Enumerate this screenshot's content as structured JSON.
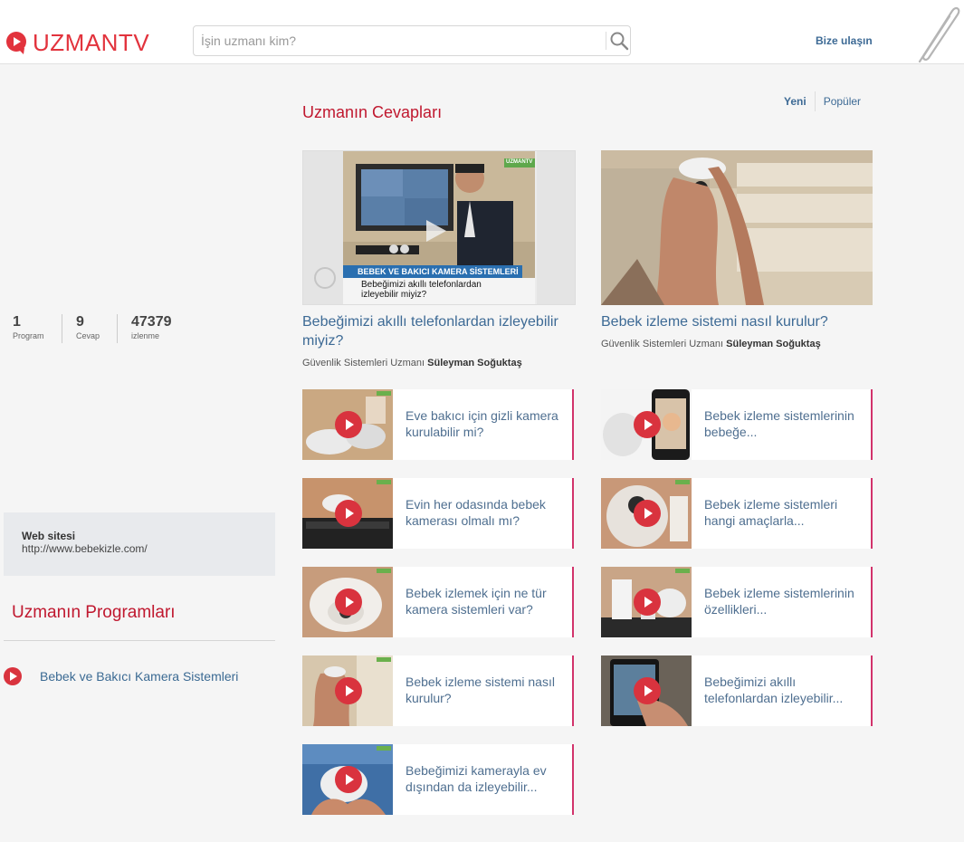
{
  "header": {
    "logo_text": "UZMANTV",
    "search_placeholder": "İşin uzmanı kim?",
    "contact_label": "Bize ulaşın"
  },
  "stats": [
    {
      "value": "1",
      "label": "Program"
    },
    {
      "value": "9",
      "label": "Cevap"
    },
    {
      "value": "47379",
      "label": "izlenme"
    }
  ],
  "website": {
    "label": "Web sitesi",
    "url": "http://www.bebekizle.com/"
  },
  "programs": {
    "title": "Uzmanın Programları",
    "items": [
      {
        "label": "Bebek ve Bakıcı Kamera Sistemleri"
      }
    ]
  },
  "main": {
    "title": "Uzmanın Cevapları",
    "tabs": [
      {
        "label": "Yeni"
      },
      {
        "label": "Popüler"
      }
    ],
    "featured": [
      {
        "title": "Bebeğimizi akıllı telefonlardan izleyebilir miyiz?",
        "expert_role": "Güvenlik Sistemleri Uzmanı",
        "expert_name": "Süleyman Soğuktaş",
        "banner_title": "BEBEK VE BAKICI KAMERA SİSTEMLERİ",
        "banner_sub": "Bebeğimizi akıllı telefonlardan izleyebilir miyiz?",
        "logo": "UZMANTV"
      },
      {
        "title": "Bebek izleme sistemi nasıl kurulur?",
        "expert_role": "Güvenlik Sistemleri Uzmanı",
        "expert_name": "Süleyman Soğuktaş"
      }
    ],
    "videos": [
      {
        "title": "Eve bakıcı için gizli kamera kurulabilir mi?"
      },
      {
        "title": "Bebek izleme sistemlerinin bebeğe..."
      },
      {
        "title": "Evin her odasında bebek kamerası olmalı mı?"
      },
      {
        "title": "Bebek izleme sistemleri hangi amaçlarla..."
      },
      {
        "title": "Bebek izlemek için ne tür kamera sistemleri var?"
      },
      {
        "title": "Bebek izleme sistemlerinin özellikleri..."
      },
      {
        "title": "Bebek izleme sistemi nasıl kurulur?"
      },
      {
        "title": "Bebeğimizi akıllı telefonlardan izleyebilir..."
      },
      {
        "title": "Bebeğimizi kamerayla ev dışından da izleyebilir..."
      }
    ]
  },
  "colors": {
    "brand_red": "#e2333d",
    "link_blue": "#3d6a95",
    "accent_pink": "#d2336b"
  }
}
